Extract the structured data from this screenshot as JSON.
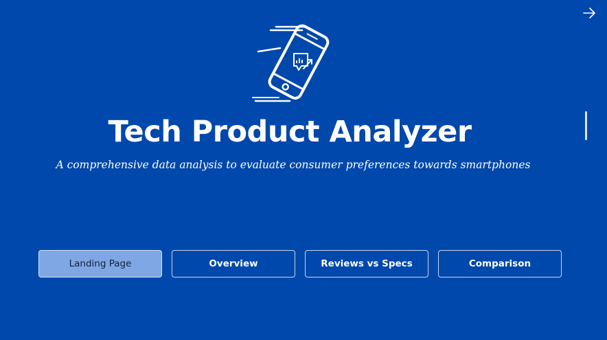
{
  "header": {
    "title": "Tech Product Analyzer",
    "subtitle": "A comprehensive data analysis to evaluate consumer preferences towards smartphones",
    "logo_icon": "smartphone-chart-icon",
    "next_icon": "arrow-right-icon"
  },
  "navigation": {
    "buttons": [
      {
        "label": "Landing Page",
        "active": true
      },
      {
        "label": "Overview",
        "active": false
      },
      {
        "label": "Reviews vs Specs",
        "active": false
      },
      {
        "label": "Comparison",
        "active": false
      }
    ]
  },
  "colors": {
    "background": "#0048ab",
    "active_button": "#7ea7e4",
    "text": "#ffffff",
    "button_border": "#c7d6ec"
  }
}
